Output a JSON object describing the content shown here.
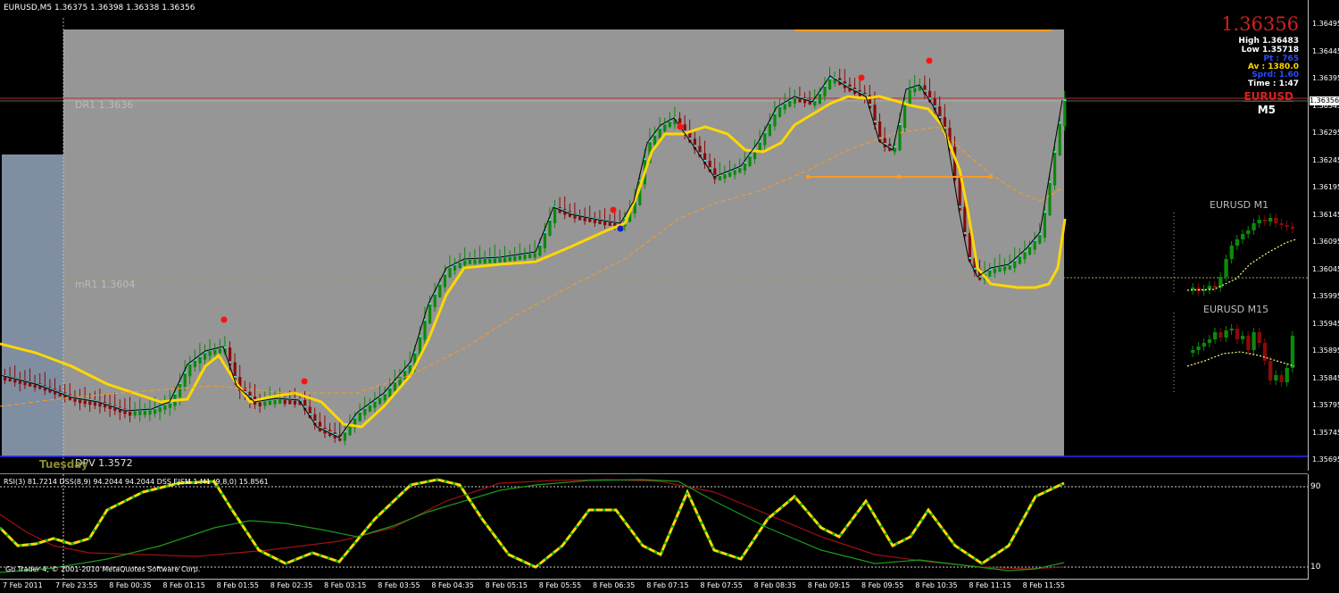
{
  "main": {
    "header": "EURUSD,M5  1.36375 1.36398 1.36338 1.36356",
    "levels": {
      "dr1": "DR1  1.3636",
      "mr1": "mR1  1.3604",
      "dpv": "DPV  1.3572"
    },
    "day_label": "Tuesday",
    "info": {
      "price": "1.36356",
      "high": "High 1.36483",
      "low": "Low 1.35718",
      "pt": "Pt : 765",
      "av": "Av : 1380.0",
      "sprd": "Sprd: 1.60",
      "time": "Time :    1:47",
      "symbol": "EURUSD",
      "timeframe": "M5"
    },
    "price_axis": [
      "1.36495",
      "1.36445",
      "1.36395",
      "1.36345",
      "1.36295",
      "1.36245",
      "1.36195",
      "1.36145",
      "1.36095",
      "1.36045",
      "1.35995",
      "1.35945",
      "1.35895",
      "1.35845",
      "1.35795",
      "1.35745",
      "1.35695"
    ],
    "price_badge": "1.36356",
    "mini_m1": "EURUSD  M1",
    "mini_m15": "EURUSD  M15"
  },
  "indicator": {
    "header": "RSI(3) 81.7214  DSS(8,9) 94.2044  94.2044  DSS EJSM 1 M1 (9,8,0) 15.8561",
    "copyright": "Go Trader 4, © 2001-2010 MetaQuotes Software Corp.",
    "level_high": "90",
    "level_low": "10"
  },
  "time_axis": [
    "7 Feb 2011",
    "7 Feb 23:55",
    "8 Feb 00:35",
    "8 Feb 01:15",
    "8 Feb 01:55",
    "8 Feb 02:35",
    "8 Feb 03:15",
    "8 Feb 03:55",
    "8 Feb 04:35",
    "8 Feb 05:15",
    "8 Feb 05:55",
    "8 Feb 06:35",
    "8 Feb 07:15",
    "8 Feb 07:55",
    "8 Feb 08:35",
    "8 Feb 09:15",
    "8 Feb 09:55",
    "8 Feb 10:35",
    "8 Feb 11:15",
    "8 Feb 11:55"
  ],
  "colors": {
    "background": "#000000",
    "session_box": "#969696",
    "prev_box": "#7f8ea0",
    "bull": "#0a8a0a",
    "bear": "#8a0a0a",
    "envelope": "#ffd700",
    "ma_dash": "#ff9a20",
    "close_line": "#000000",
    "dr1_line": "#b03030",
    "dpv_line": "#2a2aff",
    "orange_level": "#ff9a20",
    "dss_main": "#ffd700",
    "dss_dots": "#16b816",
    "rsi_red": "#a01010",
    "rsi_green": "#1a9a1a",
    "price_text": "#d42020",
    "av_text": "#ffd700",
    "blue_text": "#2a4aff"
  }
}
